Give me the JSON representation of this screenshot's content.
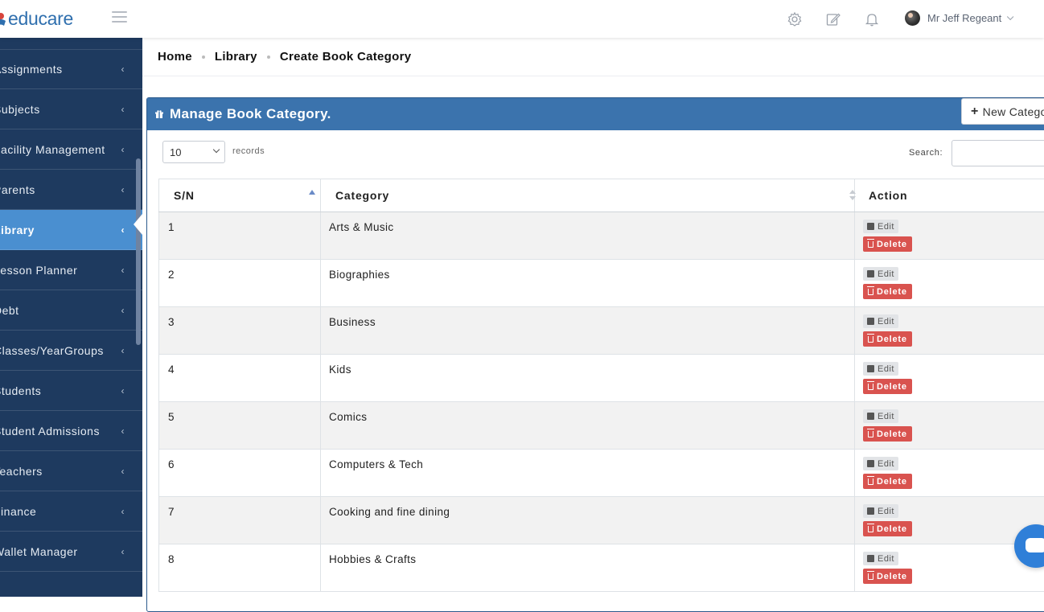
{
  "app": {
    "logo_text": "educare",
    "brand_color": "#2f6fae"
  },
  "topbar": {
    "icons": [
      "gear-icon",
      "edit-icon",
      "bell-icon"
    ],
    "user_name": "Mr Jeff Regeant"
  },
  "sidebar": {
    "items": [
      {
        "label": "Assignments",
        "active": false
      },
      {
        "label": "Subjects",
        "active": false
      },
      {
        "label": "Facility Management",
        "active": false
      },
      {
        "label": "Parents",
        "active": false
      },
      {
        "label": "Library",
        "active": true
      },
      {
        "label": "Lesson Planner",
        "active": false
      },
      {
        "label": "Debt",
        "active": false
      },
      {
        "label": "Classes/YearGroups",
        "active": false
      },
      {
        "label": "Students",
        "active": false
      },
      {
        "label": "Student Admissions",
        "active": false
      },
      {
        "label": "Teachers",
        "active": false
      },
      {
        "label": "Finance",
        "active": false
      },
      {
        "label": "Wallet Manager",
        "active": false
      }
    ]
  },
  "breadcrumb": {
    "home": "Home",
    "library": "Library",
    "current": "Create Book Category"
  },
  "card": {
    "title": "Manage Book Category.",
    "new_button": "New Category",
    "colors": {
      "header": "#3b73ad",
      "active_item": "#4a8fd0",
      "sidebar_bg": "#1e3a5f",
      "delete": "#d9534f"
    }
  },
  "table_controls": {
    "page_length": "10",
    "records_label": "records",
    "search_label": "Search:",
    "search_value": ""
  },
  "table": {
    "headers": {
      "sn": "S/N",
      "category": "Category",
      "action": "Action"
    },
    "edit_label": "Edit",
    "delete_label": "Delete",
    "rows": [
      {
        "sn": "1",
        "category": "Arts & Music"
      },
      {
        "sn": "2",
        "category": "Biographies"
      },
      {
        "sn": "3",
        "category": "Business"
      },
      {
        "sn": "4",
        "category": "Kids"
      },
      {
        "sn": "5",
        "category": "Comics"
      },
      {
        "sn": "6",
        "category": "Computers & Tech"
      },
      {
        "sn": "7",
        "category": "Cooking and fine dining"
      },
      {
        "sn": "8",
        "category": "Hobbies & Crafts"
      }
    ]
  }
}
